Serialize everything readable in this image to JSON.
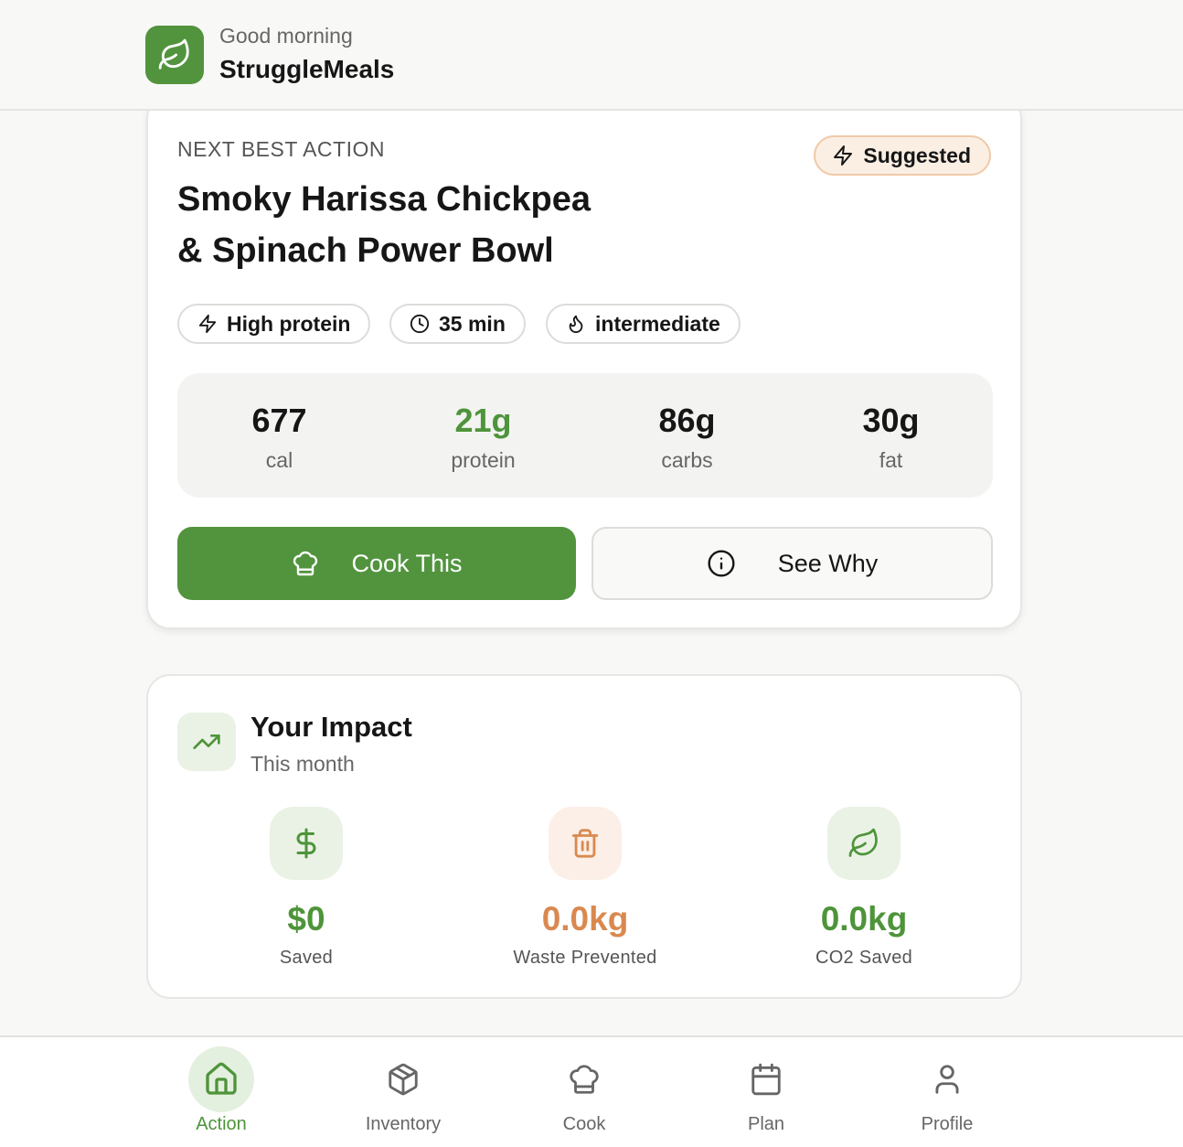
{
  "header": {
    "greeting": "Good morning",
    "app_name": "StruggleMeals",
    "logo_icon": "leaf-icon",
    "brand_color": "#52943e"
  },
  "action_card": {
    "eyebrow": "NEXT BEST ACTION",
    "badge": {
      "label": "Suggested",
      "icon": "bolt-icon"
    },
    "title_line1": "Smoky Harissa Chickpea",
    "title_line2": "& Spinach Power Bowl",
    "tags": [
      {
        "label": "High protein",
        "icon": "bolt-icon"
      },
      {
        "label": "35 min",
        "icon": "clock-icon"
      },
      {
        "label": "intermediate",
        "icon": "flame-icon"
      }
    ],
    "macros": [
      {
        "value": "677",
        "label": "cal"
      },
      {
        "value": "21g",
        "label": "protein"
      },
      {
        "value": "86g",
        "label": "carbs"
      },
      {
        "value": "30g",
        "label": "fat"
      }
    ],
    "primary_button": {
      "label": "Cook This",
      "icon": "chef-hat-icon"
    },
    "secondary_button": {
      "label": "See Why",
      "icon": "info-icon"
    }
  },
  "impact": {
    "title": "Your Impact",
    "subtitle": "This month",
    "icon": "trending-up-icon",
    "stats": [
      {
        "value": "$0",
        "label": "Saved",
        "icon": "dollar-icon",
        "color": "#4e943a"
      },
      {
        "value": "0.0kg",
        "label": "Waste Prevented",
        "icon": "trash-icon",
        "color": "#d98950"
      },
      {
        "value": "0.0kg",
        "label": "CO2 Saved",
        "icon": "leaf-icon",
        "color": "#4e943a"
      }
    ]
  },
  "nav": {
    "active": "Action",
    "items": [
      {
        "label": "Action",
        "icon": "home-icon"
      },
      {
        "label": "Inventory",
        "icon": "box-icon"
      },
      {
        "label": "Cook",
        "icon": "chef-hat-icon"
      },
      {
        "label": "Plan",
        "icon": "calendar-icon"
      },
      {
        "label": "Profile",
        "icon": "user-icon"
      }
    ]
  }
}
